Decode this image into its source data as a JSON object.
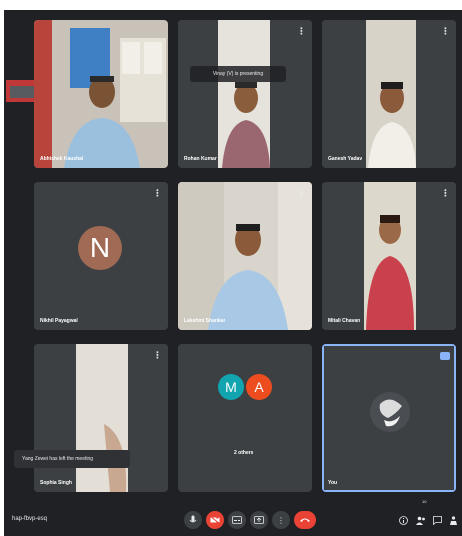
{
  "meeting": {
    "code": "hap-fbvp-esq"
  },
  "toast": {
    "presenter": "Vinay (V) is presenting",
    "joined": "Yang Zewei has left the meeting"
  },
  "tiles": [
    {
      "name": "Abhishek Kaushal"
    },
    {
      "name": "Rohan Kumar"
    },
    {
      "name": "Ganesh Yadav"
    },
    {
      "name": "Nikhil Payagwal",
      "initial": "N"
    },
    {
      "name": "Lakshmi Shankar"
    },
    {
      "name": "Mitali Chavan"
    },
    {
      "name": "Sophia Singh"
    },
    {
      "name": "2 others",
      "initials": [
        "M",
        "A"
      ]
    },
    {
      "name": "You"
    }
  ],
  "toolbar": {
    "more_badge": "10"
  },
  "colors": {
    "background": "#202124",
    "tile": "#3c4043",
    "accent": "#8ab4f8",
    "end_call": "#ea4335"
  }
}
